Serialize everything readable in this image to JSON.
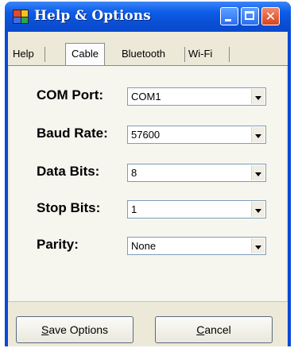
{
  "window": {
    "title": "Help & Options"
  },
  "tabs": [
    {
      "label": "Help"
    },
    {
      "label": "Cable",
      "selected": true
    },
    {
      "label": "Bluetooth"
    },
    {
      "label": "Wi-Fi"
    }
  ],
  "fields": [
    {
      "label": "COM Port:",
      "value": "COM1"
    },
    {
      "label": "Baud Rate:",
      "value": "57600"
    },
    {
      "label": "Data Bits:",
      "value": "8"
    },
    {
      "label": "Stop Bits:",
      "value": "1"
    },
    {
      "label": "Parity:",
      "value": "None"
    }
  ],
  "buttons": {
    "save": {
      "mnemonic": "S",
      "rest": "ave Options"
    },
    "cancel": {
      "mnemonic": "C",
      "rest": "ancel"
    }
  },
  "icons": {
    "app": "app-window-icon",
    "minimize": "minimize-icon",
    "maximize": "maximize-icon",
    "close": "close-icon",
    "dropdown": "chevron-down-icon"
  },
  "colors": {
    "titlebar": "#0a4fd4",
    "close_button": "#d8431d",
    "dialog_face": "#ece9d8"
  }
}
